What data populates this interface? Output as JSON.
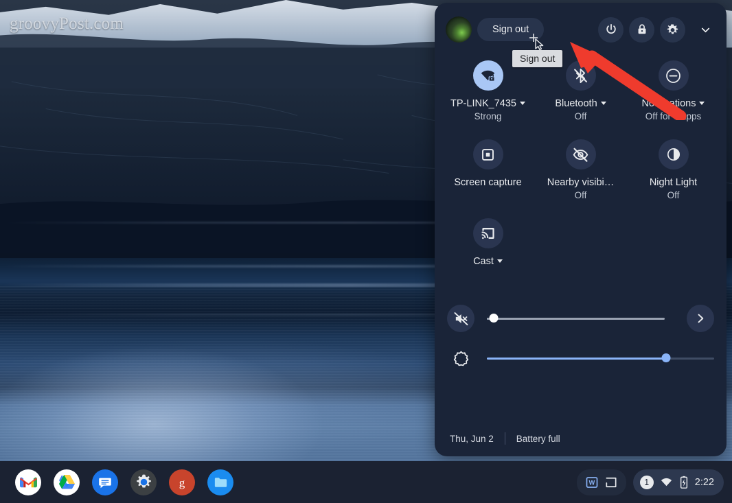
{
  "watermark": "groovyPost.com",
  "quick_settings": {
    "header": {
      "avatar_name": "user-avatar",
      "sign_out_label": "Sign out",
      "power_label": "power-icon",
      "lock_label": "lock-icon",
      "settings_label": "gear-icon",
      "collapse_label": "chevron-down-icon"
    },
    "tooltip": "Sign out",
    "tiles": [
      {
        "id": "network",
        "label": "TP-LINK_7435",
        "sub": "Strong",
        "caret": true,
        "active": true,
        "icon": "wifi-locked-icon"
      },
      {
        "id": "bluetooth",
        "label": "Bluetooth",
        "sub": "Off",
        "caret": true,
        "active": false,
        "icon": "bluetooth-off-icon"
      },
      {
        "id": "notifications",
        "label": "Notifications",
        "sub": "Off for 3 apps",
        "caret": true,
        "active": false,
        "icon": "do-not-disturb-icon"
      },
      {
        "id": "screen-capture",
        "label": "Screen capture",
        "sub": "",
        "caret": false,
        "active": false,
        "icon": "screen-capture-icon"
      },
      {
        "id": "nearby-visibility",
        "label": "Nearby visibi…",
        "sub": "Off",
        "caret": false,
        "active": false,
        "icon": "eye-off-icon"
      },
      {
        "id": "night-light",
        "label": "Night Light",
        "sub": "Off",
        "caret": false,
        "active": false,
        "icon": "night-light-icon"
      },
      {
        "id": "cast",
        "label": "Cast",
        "sub": "",
        "caret": true,
        "active": false,
        "icon": "cast-icon"
      }
    ],
    "volume": {
      "icon": "volume-mute-icon",
      "value": 4,
      "expand_icon": "chevron-right-icon"
    },
    "brightness": {
      "icon": "brightness-icon",
      "value": 79
    },
    "footer": {
      "date": "Thu, Jun 2",
      "battery": "Battery full"
    }
  },
  "shelf": {
    "apps": [
      {
        "name": "gmail",
        "label": "Gmail"
      },
      {
        "name": "google-drive",
        "label": "Google Drive"
      },
      {
        "name": "google-messages",
        "label": "Messages"
      },
      {
        "name": "settings",
        "label": "Settings"
      },
      {
        "name": "groovypost",
        "label": "groovyPost"
      },
      {
        "name": "files",
        "label": "Files"
      }
    ],
    "window_icons": [
      {
        "name": "word-window",
        "label": "W"
      },
      {
        "name": "window-overview",
        "label": "overview"
      }
    ],
    "status": {
      "notification_count": "1",
      "wifi": "wifi-icon",
      "battery": "battery-charging-icon",
      "time": "2:22"
    }
  },
  "annotation": {
    "arrow_color": "#ef3b2d"
  },
  "colors": {
    "panel_bg": "#1a2438",
    "tile_bg": "#2a3550",
    "tile_active_bg": "#a9c7f5",
    "accent_blue": "#8ab4f8",
    "shelf_bg": "#1b2232",
    "text_primary": "#e8eaed",
    "text_secondary": "#bfc6d1",
    "tooltip_bg": "#dadce0"
  }
}
